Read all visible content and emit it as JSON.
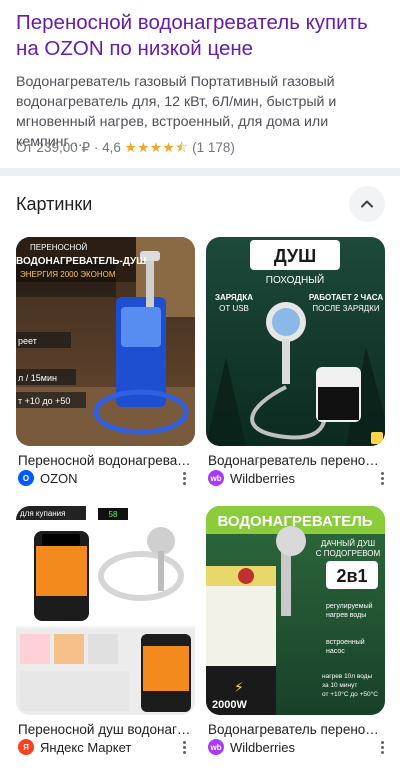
{
  "result": {
    "title": "Переносной водонагреватель купить на OZON по низкой цене",
    "snippet": "Водонагреватель газовый Портативный газовый водонагреватель для, 12 кВт, 6Л/мин, быстрый и мгновенный нагрев, встроенный, для дома или кемпинг…",
    "price": "От 239,00 ₽",
    "separator": "·",
    "rating": "4,6",
    "stars": "★★★★⯪",
    "reviews": "(1 178)"
  },
  "images_section": {
    "title": "Картинки",
    "items": [
      {
        "caption": "Переносной водонагреватель",
        "source": "OZON",
        "thumb_text": [
          "ПЕРЕНОСНОЙ",
          "ВОДОНАГРЕВАТЕЛЬ-ДУШ",
          "ЭНЕРГИЯ 2000 ЭКОНОМ",
          "реет",
          "л / 15мин",
          "т +10 до +50"
        ]
      },
      {
        "caption": "Водонагреватель переносной...",
        "source": "Wildberries",
        "thumb_text": [
          "ДУШ",
          "ПОХОДНЫЙ",
          "ЗАРЯДКА",
          "ОТ USB",
          "РАБОТАЕТ 2 ЧАСА",
          "ПОСЛЕ ЗАРЯДКИ"
        ]
      },
      {
        "caption": "Переносной душ водонагрев...",
        "source": "Яндекс Маркет",
        "thumb_text": [
          "для купания",
          "58"
        ]
      },
      {
        "caption": "Водонагреватель переносной...",
        "source": "Wildberries",
        "thumb_text": [
          "ВОДОНАГРЕВАТЕЛЬ",
          "ДАЧНЫЙ ДУШ",
          "С ПОДОГРЕВОМ",
          "2в1",
          "регулируемый",
          "нагрев воды",
          "встроенный",
          "насос",
          "нагрев 10л воды",
          "за 10 минут",
          "от +10°С до +50°С",
          "2000W"
        ]
      }
    ]
  },
  "colors": {
    "title_link": "#681da8",
    "ozon": "#005bff",
    "wildberries": "#a73afd",
    "yandex": "#fc3f1d",
    "stars": "#f5a623"
  }
}
